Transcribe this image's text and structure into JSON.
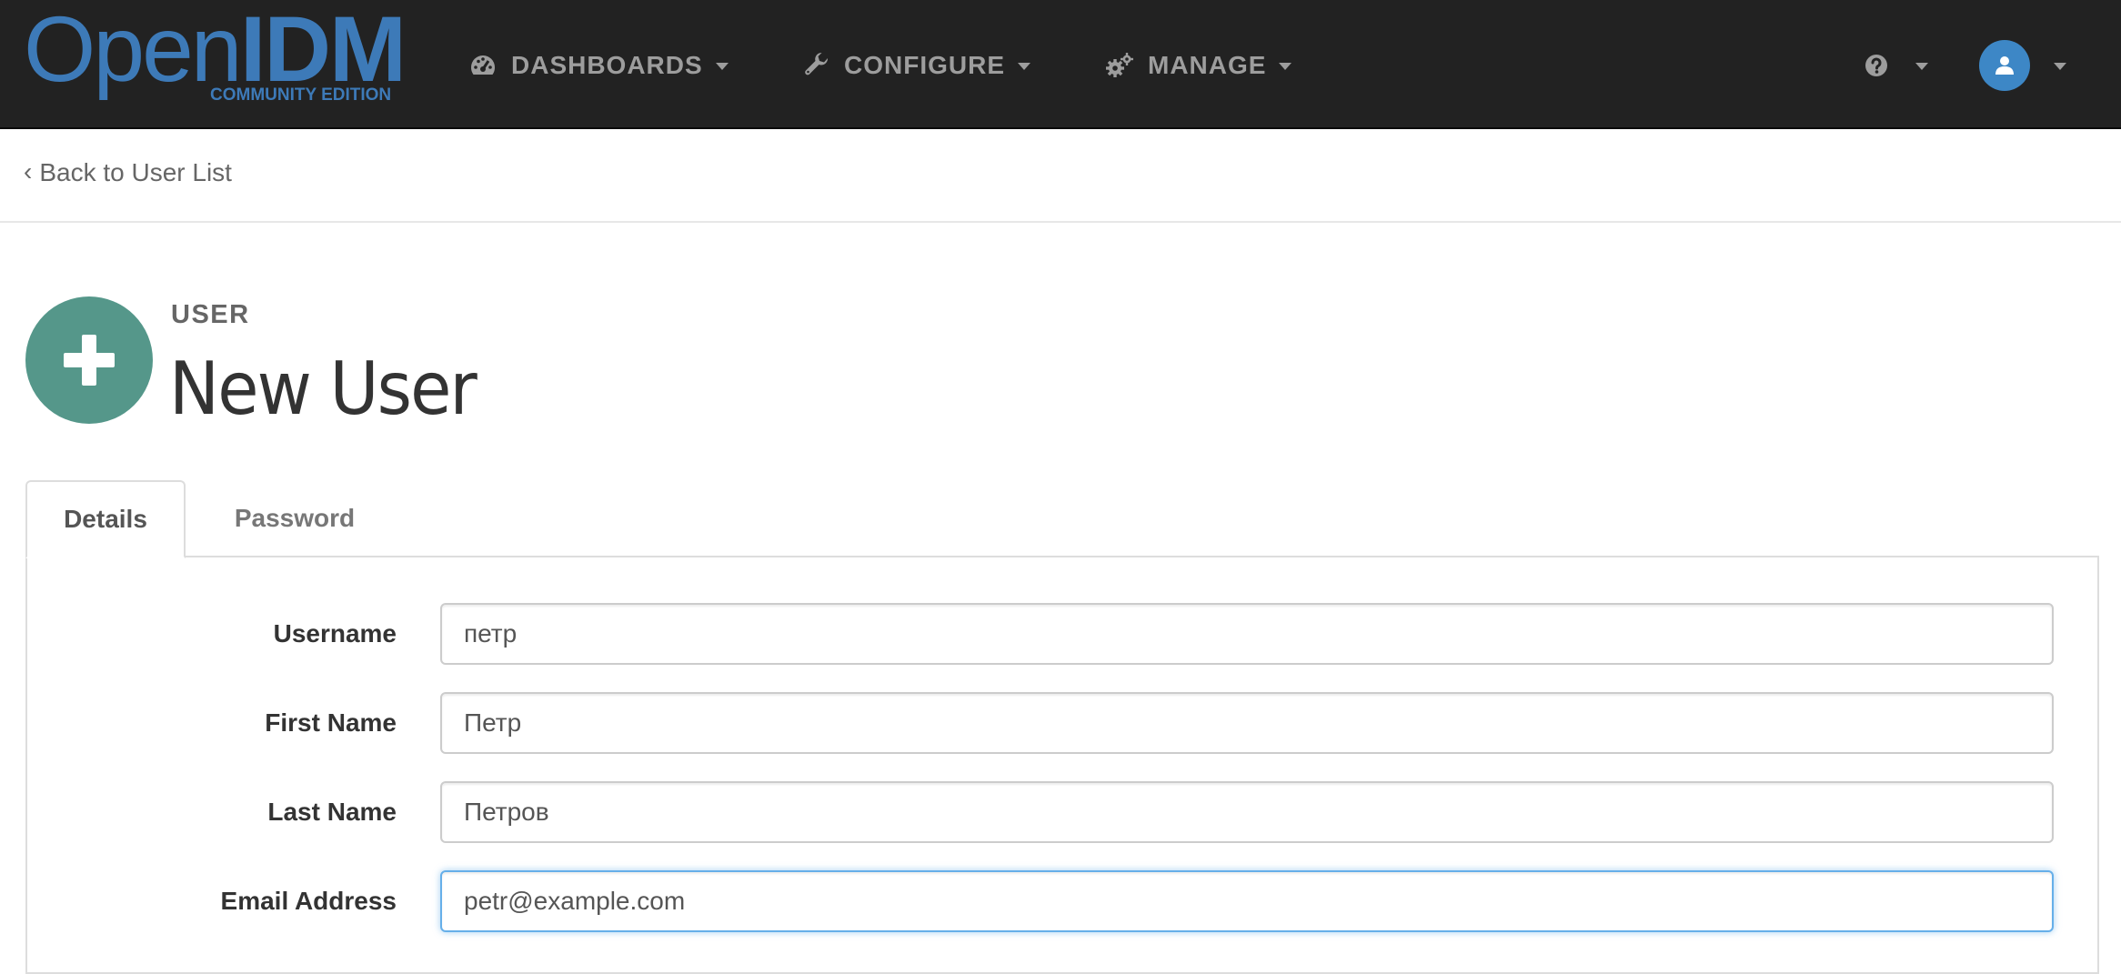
{
  "brand": {
    "name_part1": "Open",
    "name_part2": "IDM",
    "edition": "COMMUNITY EDITION"
  },
  "nav": {
    "dashboards": {
      "label": "DASHBOARDS",
      "icon": "dashboard-gauge-icon"
    },
    "configure": {
      "label": "CONFIGURE",
      "icon": "wrench-icon"
    },
    "manage": {
      "label": "MANAGE",
      "icon": "gears-icon"
    },
    "help": {
      "icon": "question-circle-icon"
    },
    "user": {
      "icon": "user-avatar-icon"
    }
  },
  "breadcrumb": {
    "back_label": "Back to User List"
  },
  "header": {
    "subtitle": "USER",
    "title": "New User",
    "icon": "plus-icon"
  },
  "tabs": [
    {
      "label": "Details",
      "active": true
    },
    {
      "label": "Password",
      "active": false
    }
  ],
  "form": {
    "username": {
      "label": "Username",
      "value": "петр"
    },
    "first_name": {
      "label": "First Name",
      "value": "Петр"
    },
    "last_name": {
      "label": "Last Name",
      "value": "Петров"
    },
    "email": {
      "label": "Email Address",
      "value": "petr@example.com"
    }
  },
  "colors": {
    "navbar_bg": "#222222",
    "brand_blue": "#3d7ab8",
    "nav_text": "#9d9d9d",
    "header_icon_bg": "#55978a",
    "avatar_bg": "#3d87c6",
    "focus_border": "#66afe9"
  }
}
